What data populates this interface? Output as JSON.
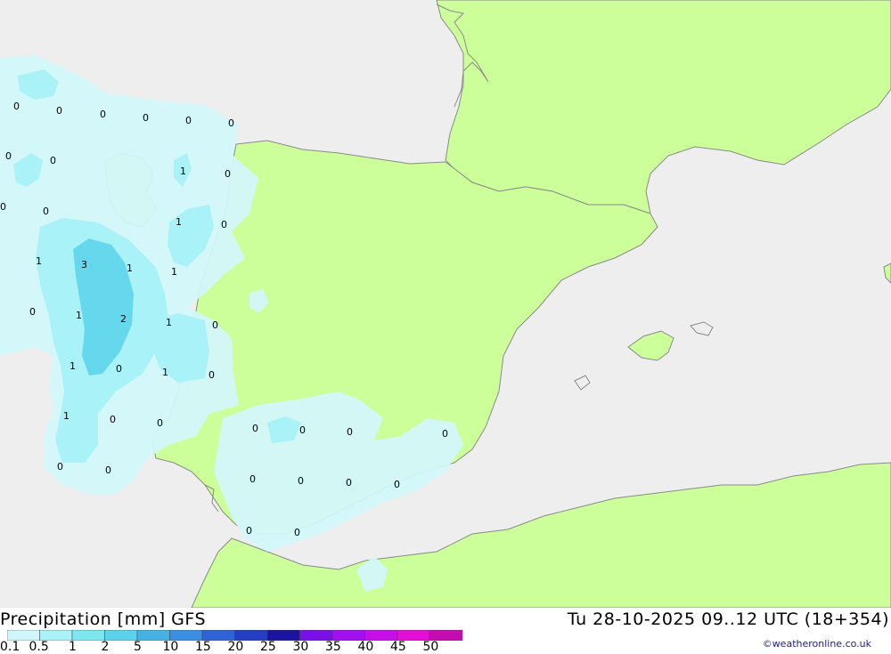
{
  "map": {
    "colors": {
      "sea": "#eeeeee",
      "land": "#ccff99",
      "coast": "#8a8a8a",
      "precip_light": "#d2f7fa",
      "precip_mid": "#a9f2f7",
      "precip_heavy": "#66d8ee"
    },
    "contour_labels": [
      {
        "id": "a",
        "text": "0"
      },
      {
        "id": "b",
        "text": "0"
      },
      {
        "id": "c",
        "text": "0"
      },
      {
        "id": "d",
        "text": "0"
      },
      {
        "id": "e",
        "text": "0"
      },
      {
        "id": "f",
        "text": "0"
      },
      {
        "id": "g",
        "text": "0"
      },
      {
        "id": "h",
        "text": "0"
      },
      {
        "id": "i",
        "text": "1"
      },
      {
        "id": "j",
        "text": "0"
      },
      {
        "id": "k",
        "text": "0"
      },
      {
        "id": "l",
        "text": "0"
      },
      {
        "id": "m",
        "text": "1"
      },
      {
        "id": "n",
        "text": "0"
      },
      {
        "id": "o",
        "text": "1"
      },
      {
        "id": "p",
        "text": "3"
      },
      {
        "id": "q",
        "text": "1"
      },
      {
        "id": "r",
        "text": "1"
      },
      {
        "id": "s",
        "text": "0"
      },
      {
        "id": "t",
        "text": "1"
      },
      {
        "id": "u",
        "text": "2"
      },
      {
        "id": "v",
        "text": "1"
      },
      {
        "id": "w",
        "text": "0"
      },
      {
        "id": "x",
        "text": "1"
      },
      {
        "id": "y",
        "text": "0"
      },
      {
        "id": "z",
        "text": "1"
      },
      {
        "id": "aa",
        "text": "0"
      },
      {
        "id": "ab",
        "text": "1"
      },
      {
        "id": "ac",
        "text": "0"
      },
      {
        "id": "ad",
        "text": "0"
      },
      {
        "id": "ae",
        "text": "0"
      },
      {
        "id": "af",
        "text": "0"
      },
      {
        "id": "ag",
        "text": "0"
      },
      {
        "id": "ah",
        "text": "0"
      },
      {
        "id": "ai",
        "text": "0"
      },
      {
        "id": "aj",
        "text": "0"
      },
      {
        "id": "ak",
        "text": "0"
      },
      {
        "id": "al",
        "text": "0"
      },
      {
        "id": "am",
        "text": "0"
      },
      {
        "id": "an",
        "text": "0"
      },
      {
        "id": "ao",
        "text": "0"
      },
      {
        "id": "ap",
        "text": "0"
      }
    ]
  },
  "footer": {
    "title": "Precipitation [mm] GFS",
    "datetime": "Tu 28-10-2025 09..12 UTC (18+354)",
    "credit": "©weatheronline.co.uk",
    "scale": {
      "labels": [
        "0.1",
        "0.5",
        "1",
        "2",
        "5",
        "10",
        "15",
        "20",
        "25",
        "30",
        "35",
        "40",
        "45",
        "50"
      ],
      "colors": [
        "#d2f7fa",
        "#a9f2f7",
        "#7de7f0",
        "#5cd3ea",
        "#46b2e4",
        "#3b8fe0",
        "#2f63d6",
        "#2340c2",
        "#1a14a0",
        "#7a10e8",
        "#a010f0",
        "#c80ee8",
        "#e40ed8",
        "#c40cb0"
      ]
    }
  }
}
